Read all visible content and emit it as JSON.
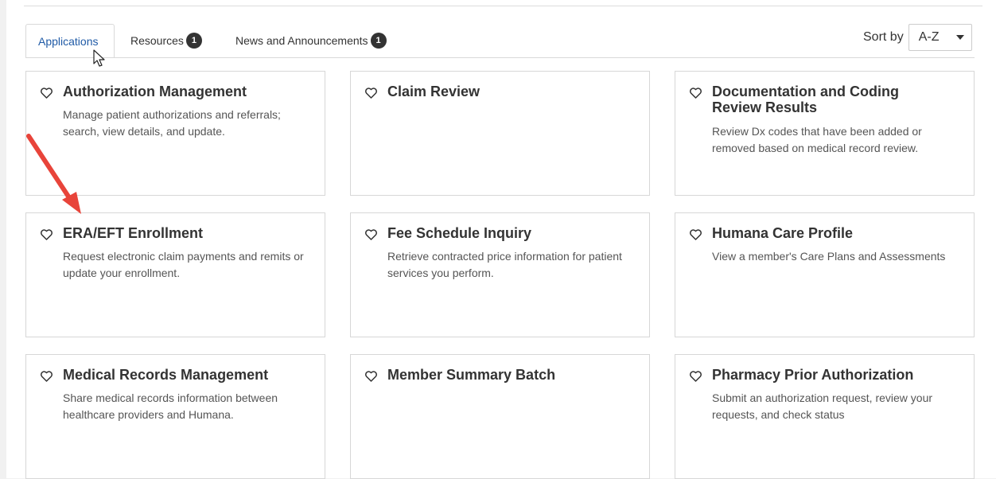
{
  "tabs": [
    {
      "label": "Applications",
      "active": true
    },
    {
      "label": "Resources",
      "badge": "1"
    },
    {
      "label": "News and Announcements",
      "badge": "1"
    }
  ],
  "sort": {
    "label": "Sort by",
    "value": "A-Z"
  },
  "colors": {
    "active_tab": "#1f5aa6",
    "arrow": "#e8443a",
    "badge": "#333333"
  },
  "cards": [
    {
      "title": "Authorization Management",
      "desc": "Manage patient authorizations and referrals; search, view details, and update.",
      "icon": "heart-outline-icon"
    },
    {
      "title": "Claim Review",
      "desc": "",
      "icon": "heart-outline-icon"
    },
    {
      "title": "Documentation and Coding Review Results",
      "desc": "Review Dx codes that have been added or removed based on medical record review.",
      "icon": "heart-outline-icon"
    },
    {
      "title": "ERA/EFT Enrollment",
      "desc": "Request electronic claim payments and remits or update your enrollment.",
      "icon": "heart-outline-icon"
    },
    {
      "title": "Fee Schedule Inquiry",
      "desc": "Retrieve contracted price information for patient services you perform.",
      "icon": "heart-outline-icon"
    },
    {
      "title": "Humana Care Profile",
      "desc": "View a member's Care Plans and Assessments",
      "icon": "heart-outline-icon"
    },
    {
      "title": "Medical Records Management",
      "desc": "Share medical records information between healthcare providers and Humana.",
      "icon": "heart-outline-icon"
    },
    {
      "title": "Member Summary Batch",
      "desc": "",
      "icon": "heart-outline-icon"
    },
    {
      "title": "Pharmacy Prior Authorization",
      "desc": "Submit an authorization request, review your requests, and check status",
      "icon": "heart-outline-icon"
    }
  ]
}
